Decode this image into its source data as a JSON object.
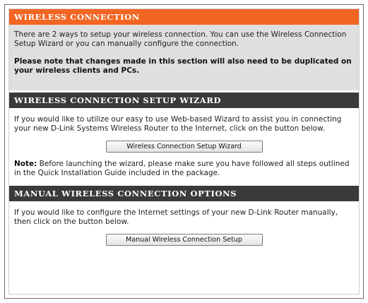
{
  "wireless_connection": {
    "header": "WIRELESS CONNECTION",
    "intro": "There are 2 ways to setup your wireless connection. You can use the Wireless Connection Setup Wizard or you can manually configure the connection.",
    "note": "Please note that changes made in this section will also need to be duplicated on your wireless clients and PCs."
  },
  "wizard_section": {
    "header": "WIRELESS CONNECTION SETUP WIZARD",
    "description": "If you would like to utilize our easy to use Web-based Wizard to assist you in connecting your new D-Link Systems Wireless Router to the Internet, click on the button below.",
    "button_label": "Wireless Connection Setup Wizard",
    "note_label": "Note:",
    "note_text": " Before launching the wizard, please make sure you have followed all steps outlined in the Quick Installation Guide included in the package."
  },
  "manual_section": {
    "header": "MANUAL WIRELESS CONNECTION OPTIONS",
    "description": "If you would like to configure the Internet settings of your new D-Link Router manually, then click on the button below.",
    "button_label": "Manual Wireless Connection Setup"
  },
  "colors": {
    "orange_header": "#f26522",
    "dark_header": "#3a3a3a",
    "intro_background": "#dfdfdf"
  }
}
